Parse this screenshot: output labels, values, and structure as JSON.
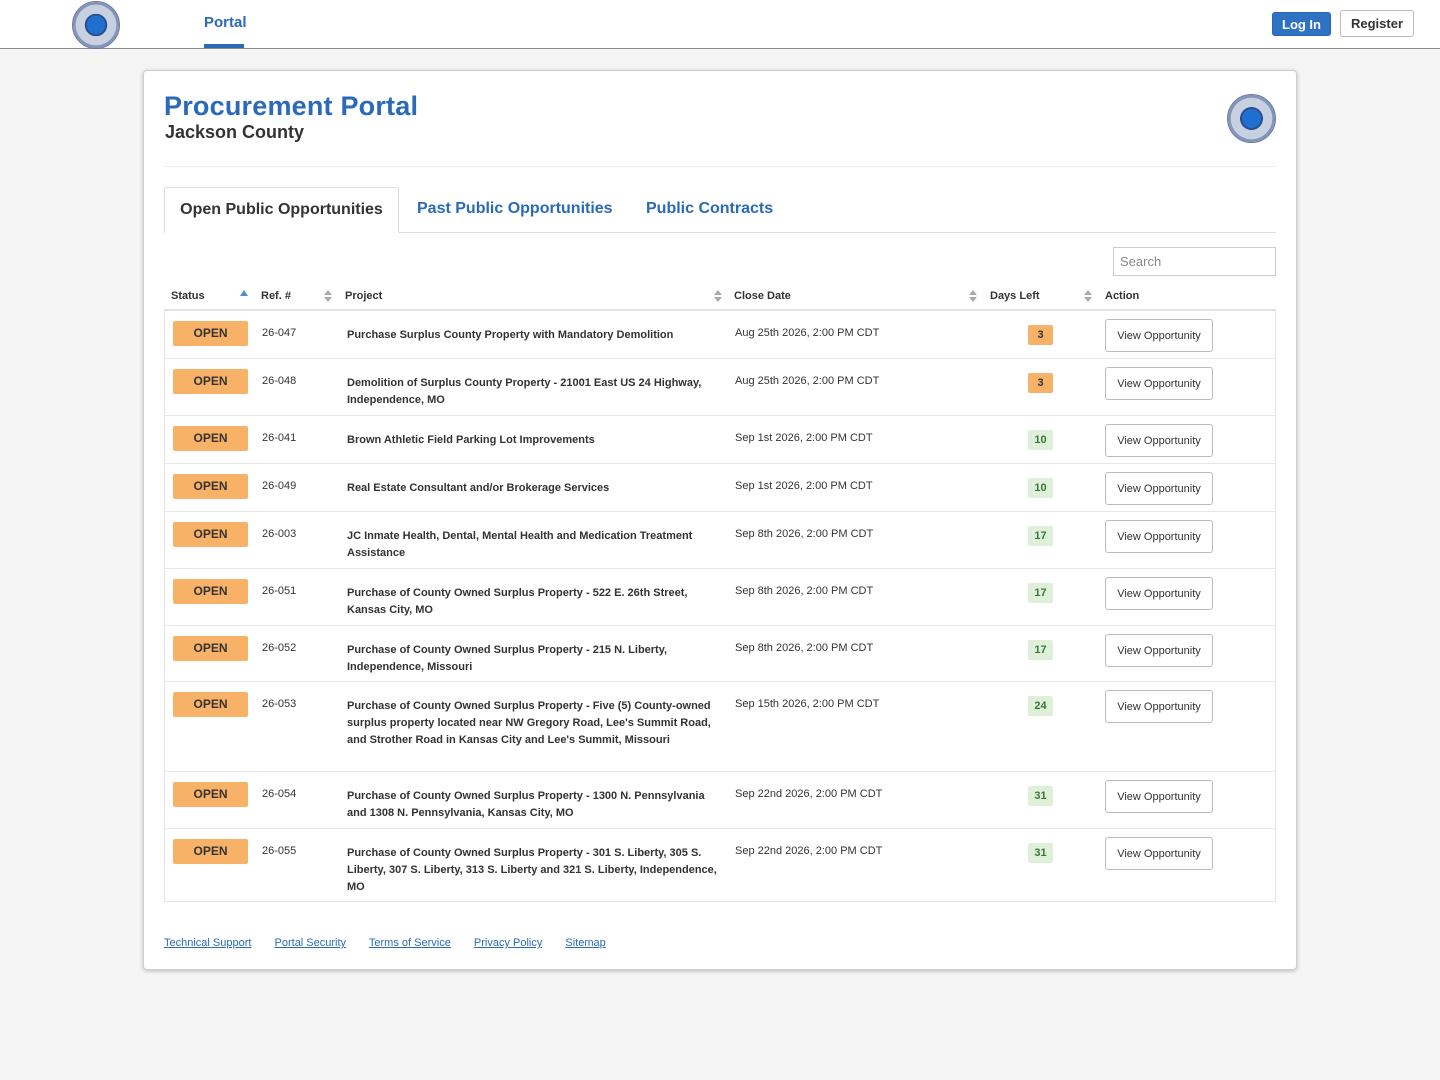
{
  "nav": {
    "portal_label": "Portal",
    "login_label": "Log In",
    "register_label": "Register"
  },
  "header": {
    "title": "Procurement Portal",
    "subtitle": "Jackson County"
  },
  "tabs": [
    {
      "label": "Open Public Opportunities",
      "active": true
    },
    {
      "label": "Past Public Opportunities",
      "active": false
    },
    {
      "label": "Public Contracts",
      "active": false
    }
  ],
  "search": {
    "placeholder": "Search"
  },
  "columns": {
    "status": "Status",
    "ref": "Ref. #",
    "project": "Project",
    "close_date": "Close Date",
    "days_left": "Days Left",
    "action": "Action"
  },
  "rows": [
    {
      "status": "OPEN",
      "ref": "26-047",
      "project": "Purchase Surplus County Property with Mandatory Demolition",
      "close_date": "Aug 25th 2026, 2:00 PM CDT",
      "days_left": "3",
      "urgent": true,
      "action": "View Opportunity"
    },
    {
      "status": "OPEN",
      "ref": "26-048",
      "project": "Demolition of Surplus County Property - 21001 East US 24 Highway, Independence, MO",
      "close_date": "Aug 25th 2026, 2:00 PM CDT",
      "days_left": "3",
      "urgent": true,
      "action": "View Opportunity"
    },
    {
      "status": "OPEN",
      "ref": "26-041",
      "project": "Brown Athletic Field Parking Lot Improvements",
      "close_date": "Sep 1st 2026, 2:00 PM CDT",
      "days_left": "10",
      "urgent": false,
      "action": "View Opportunity"
    },
    {
      "status": "OPEN",
      "ref": "26-049",
      "project": "Real Estate Consultant and/or Brokerage Services",
      "close_date": "Sep 1st 2026, 2:00 PM CDT",
      "days_left": "10",
      "urgent": false,
      "action": "View Opportunity"
    },
    {
      "status": "OPEN",
      "ref": "26-003",
      "project": "JC Inmate Health, Dental, Mental Health and Medication Treatment Assistance",
      "close_date": "Sep 8th 2026, 2:00 PM CDT",
      "days_left": "17",
      "urgent": false,
      "action": "View Opportunity"
    },
    {
      "status": "OPEN",
      "ref": "26-051",
      "project": "Purchase of County Owned Surplus Property - 522 E. 26th Street, Kansas City, MO",
      "close_date": "Sep 8th 2026, 2:00 PM CDT",
      "days_left": "17",
      "urgent": false,
      "action": "View Opportunity"
    },
    {
      "status": "OPEN",
      "ref": "26-052",
      "project": "Purchase of County Owned Surplus Property - 215 N. Liberty, Independence, Missouri",
      "close_date": "Sep 8th 2026, 2:00 PM CDT",
      "days_left": "17",
      "urgent": false,
      "action": "View Opportunity"
    },
    {
      "status": "OPEN",
      "ref": "26-053",
      "project": "Purchase of County Owned Surplus Property - Five (5) County-owned surplus property located near NW Gregory Road, Lee's Summit Road, and Strother Road in Kansas City and Lee's Summit, Missouri",
      "close_date": "Sep 15th 2026, 2:00 PM CDT",
      "days_left": "24",
      "urgent": false,
      "action": "View Opportunity"
    },
    {
      "status": "OPEN",
      "ref": "26-054",
      "project": "Purchase of County Owned Surplus Property - 1300 N. Pennsylvania and 1308 N. Pennsylvania, Kansas City, MO",
      "close_date": "Sep 22nd 2026, 2:00 PM CDT",
      "days_left": "31",
      "urgent": false,
      "action": "View Opportunity"
    },
    {
      "status": "OPEN",
      "ref": "26-055",
      "project": "Purchase of County Owned Surplus Property - 301 S. Liberty, 305 S. Liberty, 307 S. Liberty, 313 S. Liberty and 321 S. Liberty, Independence, MO",
      "close_date": "Sep 22nd 2026, 2:00 PM CDT",
      "days_left": "31",
      "urgent": false,
      "action": "View Opportunity"
    }
  ],
  "footer": {
    "links": [
      "Technical Support",
      "Portal Security",
      "Terms of Service",
      "Privacy Policy",
      "Sitemap"
    ]
  },
  "colors": {
    "brand": "#2a6ab8",
    "open_badge": "#f7b267",
    "days_ok_bg": "#dff0d8",
    "days_ok_text": "#3c763d"
  },
  "icons": {
    "seal": "county-seal-icon"
  }
}
